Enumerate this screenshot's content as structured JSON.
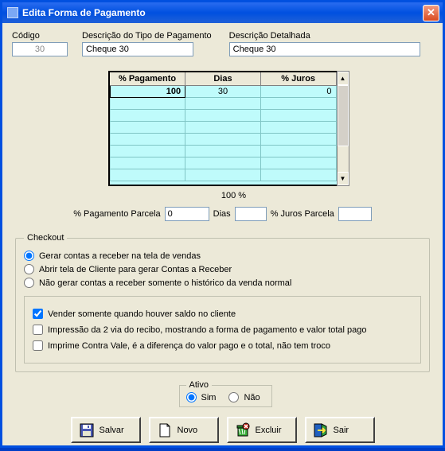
{
  "window": {
    "title": "Edita Forma de Pagamento"
  },
  "fields": {
    "codigo_label": "Código",
    "codigo_value": "30",
    "tipo_label": "Descrição do Tipo de Pagamento",
    "tipo_value": "Cheque 30",
    "detalhada_label": "Descrição Detalhada",
    "detalhada_value": "Cheque 30"
  },
  "grid": {
    "headers": [
      "% Pagamento",
      "Dias",
      "% Juros"
    ],
    "rows": [
      {
        "pct": "100",
        "dias": "30",
        "juros": "0"
      }
    ],
    "total_label": "100 %"
  },
  "parcela": {
    "pct_label": "% Pagamento Parcela",
    "pct_value": "0",
    "dias_label": "Dias",
    "dias_value": "",
    "juros_label": "% Juros Parcela",
    "juros_value": ""
  },
  "checkout": {
    "legend": "Checkout",
    "radios": [
      "Gerar contas a receber na tela de vendas",
      "Abrir tela de Cliente para gerar Contas a Receber",
      "Não gerar contas a receber somente o histórico da venda normal"
    ],
    "chks": [
      "Vender somente quando houver saldo no cliente",
      "Impressão da 2 via do recibo, mostrando a forma de pagamento e valor total pago",
      "Imprime Contra Vale, é a diferença do valor pago e o total, não tem troco"
    ]
  },
  "ativo": {
    "legend": "Ativo",
    "sim": "Sim",
    "nao": "Não"
  },
  "buttons": {
    "salvar": "Salvar",
    "novo": "Novo",
    "excluir": "Excluir",
    "sair": "Sair"
  }
}
